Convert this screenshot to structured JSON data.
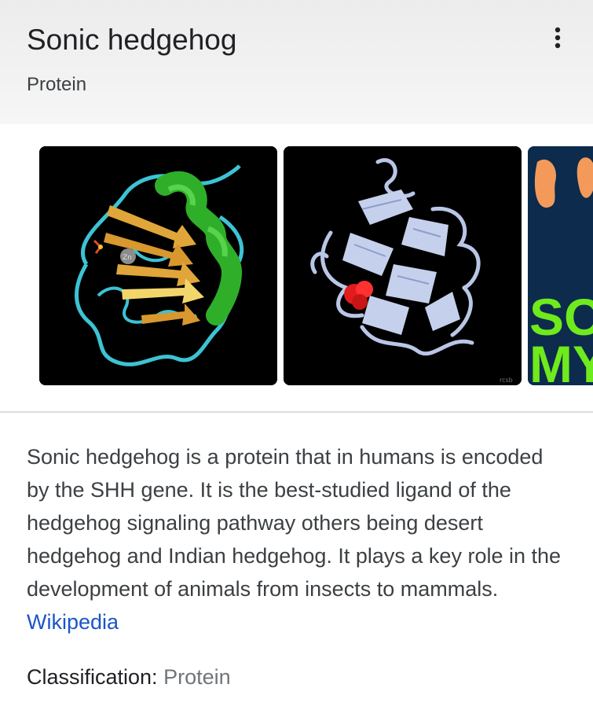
{
  "header": {
    "title": "Sonic hedgehog",
    "subtitle": "Protein"
  },
  "icons": {
    "more": "more-vert-icon"
  },
  "images": [
    {
      "name": "protein-structure-ribbon"
    },
    {
      "name": "protein-structure-blue"
    },
    {
      "name": "sonic-poster",
      "visible_text": "SO MY"
    }
  ],
  "description": {
    "text": "Sonic hedgehog is a protein that in humans is encoded by the SHH gene. It is the best-studied ligand of the hedgehog signaling pathway others being desert hedgehog and Indian hedgehog. It plays a key role in the development of animals from insects to mammals.",
    "source_link": "Wikipedia"
  },
  "facts": {
    "classification_label": "Classification:",
    "classification_value": "Protein"
  },
  "colors": {
    "link": "#1a56c4",
    "header_bg": "#f1f1f1"
  }
}
